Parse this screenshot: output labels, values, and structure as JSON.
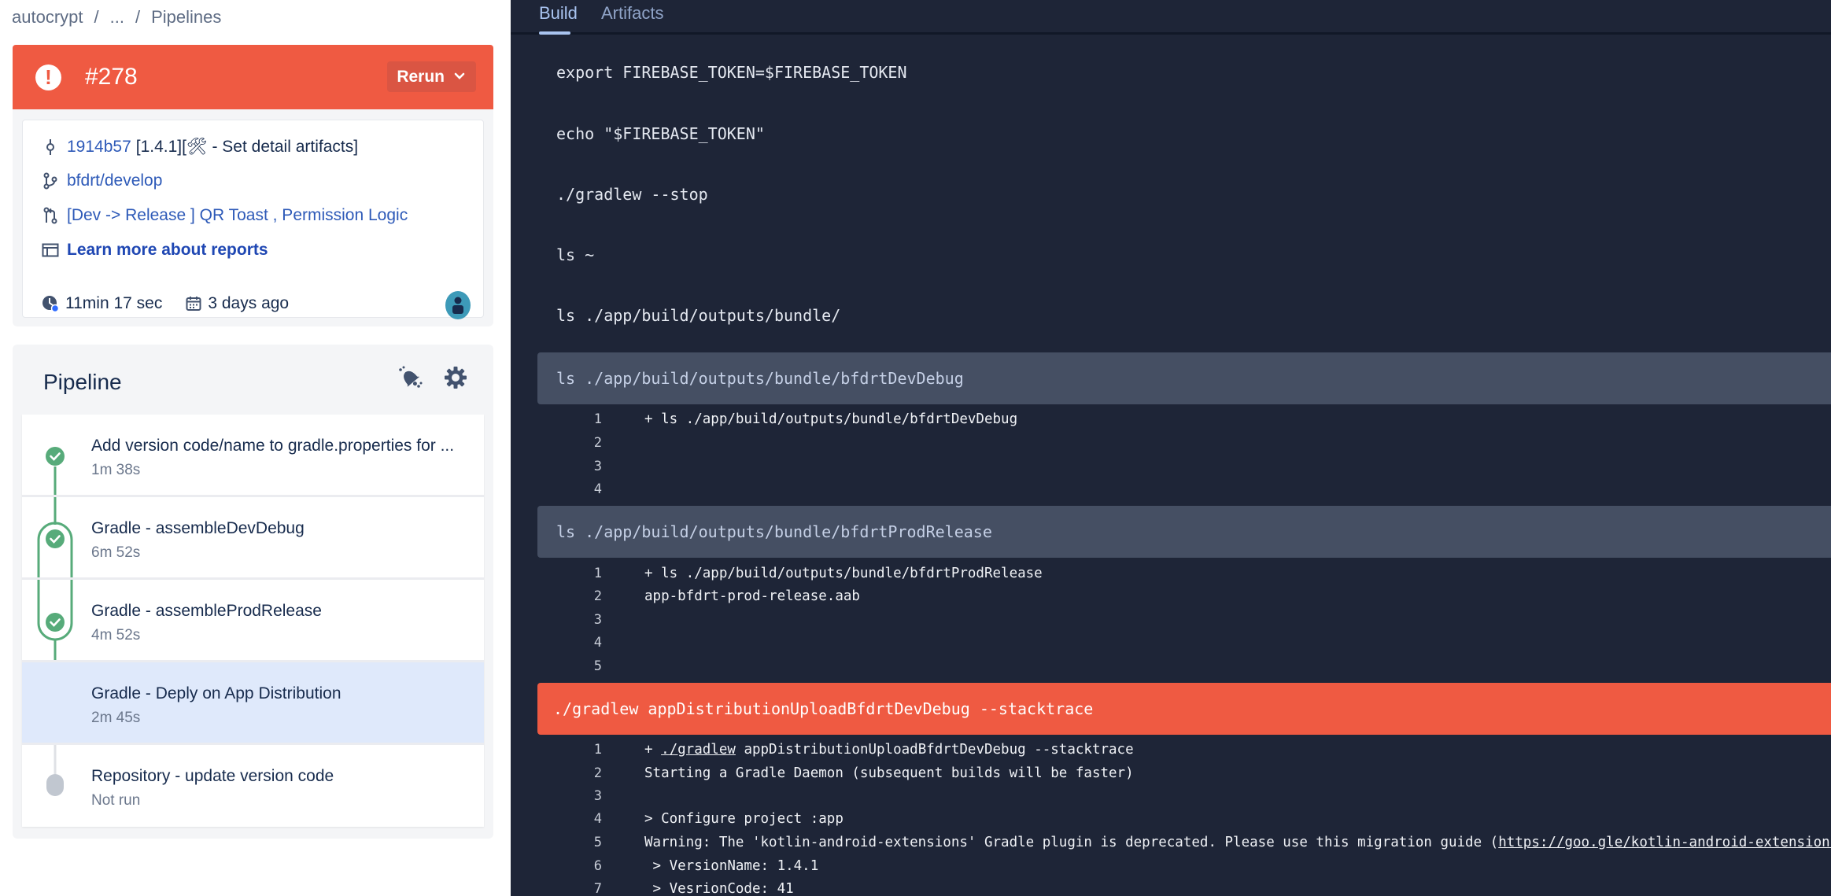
{
  "breadcrumb": [
    "autocrypt",
    "...",
    "Pipelines"
  ],
  "run": {
    "status": "failed",
    "id": "#278",
    "rerun_label": "Rerun",
    "commit_hash": "1914b57",
    "commit_message": "[1.4.1][🛠 - Set detail artifacts]",
    "branch": "bfdrt/develop",
    "pull_request": "[Dev -> Release ] QR Toast , Permission Logic",
    "reports_link": "Learn more about reports",
    "duration": "11min 17 sec",
    "started": "3 days ago"
  },
  "pipeline": {
    "title": "Pipeline",
    "steps": [
      {
        "name": "Add version code/name to gradle.properties for ...",
        "duration": "1m 38s",
        "status": "success"
      },
      {
        "name": "Gradle - assembleDevDebug",
        "duration": "6m 52s",
        "status": "success"
      },
      {
        "name": "Gradle - assembleProdRelease",
        "duration": "4m 52s",
        "status": "success"
      },
      {
        "name": "Gradle - Deply on App Distribution",
        "duration": "2m 45s",
        "status": "failed"
      },
      {
        "name": "Repository - update version code",
        "duration": "Not run",
        "status": "not-run"
      }
    ]
  },
  "tabs": {
    "build": "Build",
    "artifacts": "Artifacts",
    "active": "Build"
  },
  "log": {
    "commands": [
      "export FIREBASE_TOKEN=$FIREBASE_TOKEN",
      "echo \"$FIREBASE_TOKEN\"",
      "./gradlew --stop",
      "ls ~",
      "ls ./app/build/outputs/bundle/"
    ],
    "blocks": [
      {
        "command": "ls ./app/build/outputs/bundle/bfdrtDevDebug",
        "status": "success",
        "lines": [
          {
            "n": "1",
            "text": "+ ls ./app/build/outputs/bundle/bfdrtDevDebug"
          },
          {
            "n": "2",
            "text": ""
          },
          {
            "n": "3",
            "text": ""
          },
          {
            "n": "4",
            "text": ""
          }
        ]
      },
      {
        "command": "ls ./app/build/outputs/bundle/bfdrtProdRelease",
        "status": "success",
        "lines": [
          {
            "n": "1",
            "text": "+ ls ./app/build/outputs/bundle/bfdrtProdRelease"
          },
          {
            "n": "2",
            "text": "app-bfdrt-prod-release.aab"
          },
          {
            "n": "3",
            "text": ""
          },
          {
            "n": "4",
            "text": ""
          },
          {
            "n": "5",
            "text": ""
          }
        ]
      },
      {
        "command": "./gradlew appDistributionUploadBfdrtDevDebug --stacktrace",
        "status": "failed",
        "lines": [
          {
            "n": "1",
            "prefix": "+ ",
            "link": "./gradlew",
            "text": " appDistributionUploadBfdrtDevDebug --stacktrace"
          },
          {
            "n": "2",
            "text": "Starting a Gradle Daemon (subsequent builds will be faster)"
          },
          {
            "n": "3",
            "text": ""
          },
          {
            "n": "4",
            "text": "> Configure project :app"
          },
          {
            "n": "5",
            "text": "Warning: The 'kotlin-android-extensions' Gradle plugin is deprecated. Please use this migration guide (",
            "link": "https://goo.gle/kotlin-android-extensions-deprecation"
          },
          {
            "n": "6",
            "text": " > VersionName: 1.4.1"
          },
          {
            "n": "7",
            "text": " > VesrionCode: 41"
          }
        ]
      }
    ]
  },
  "colors": {
    "failed": "#ef5a42",
    "success": "#57ab7a",
    "not_run": "#c1c7d0",
    "log_bg": "#1e2537",
    "link": "#2e5ab8"
  }
}
